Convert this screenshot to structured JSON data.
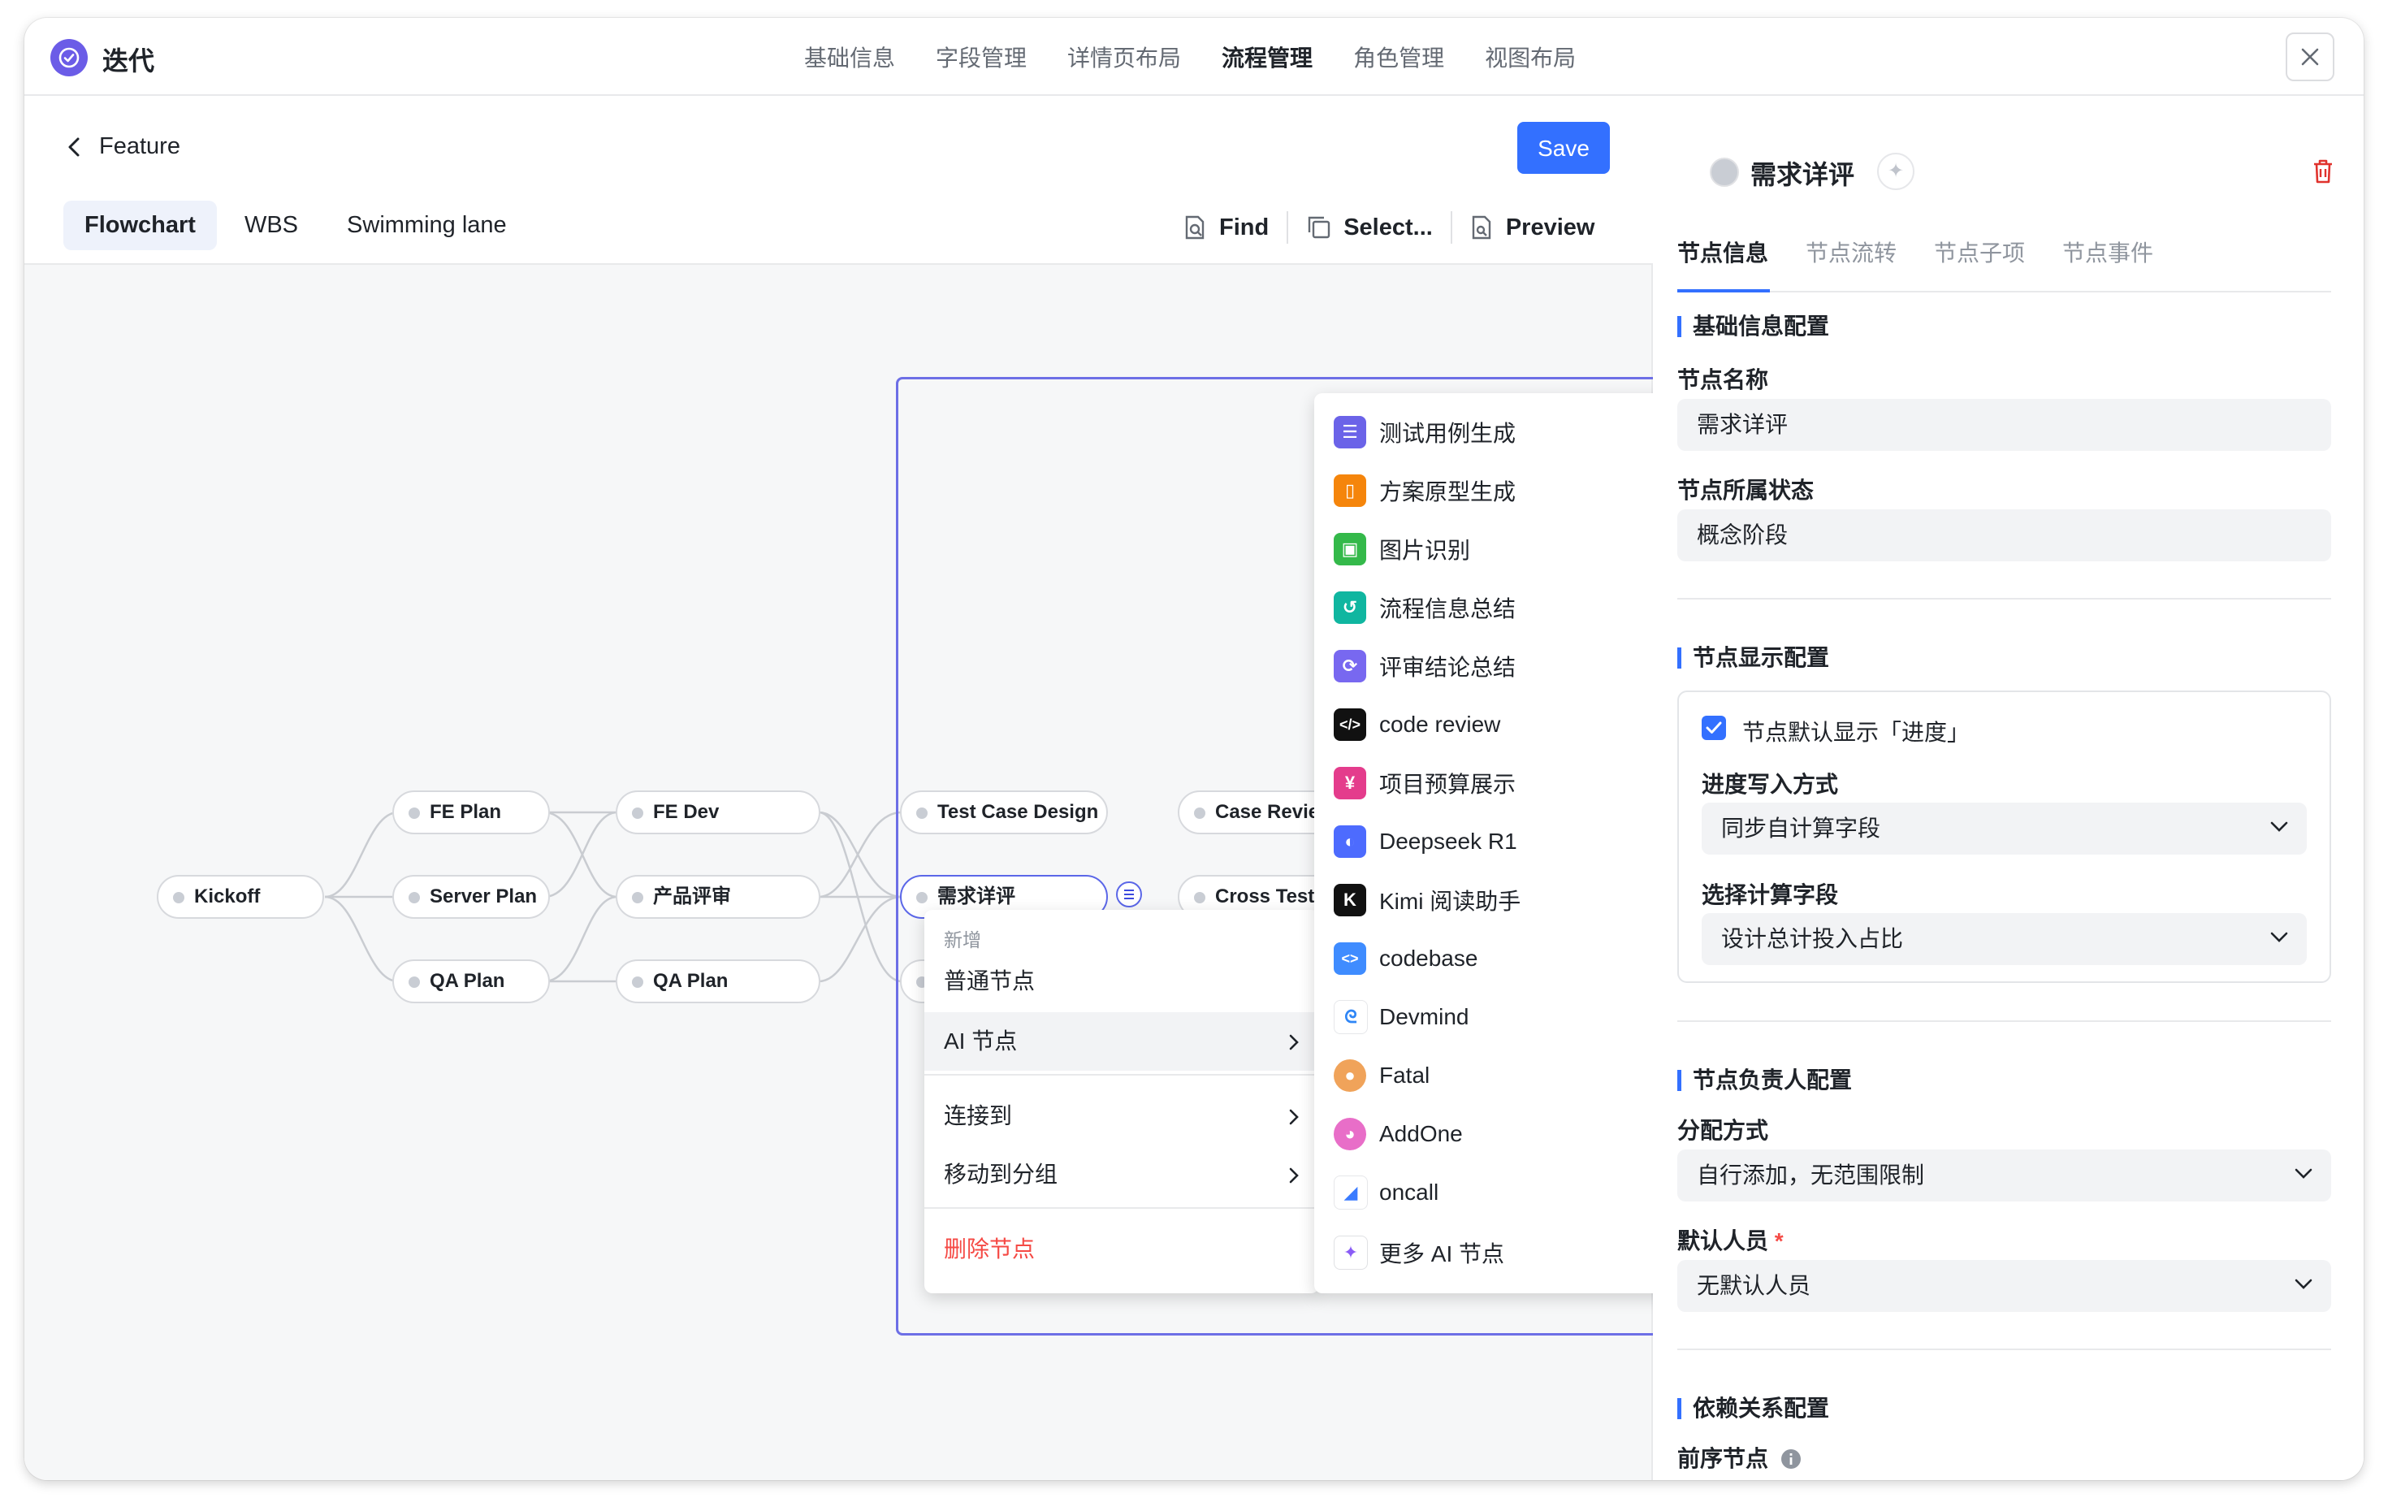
{
  "app": {
    "title": "迭代"
  },
  "top_tabs": [
    "基础信息",
    "字段管理",
    "详情页布局",
    "流程管理",
    "角色管理",
    "视图布局"
  ],
  "editor": {
    "back_label": "Feature",
    "save_label": "Save",
    "view_tabs": [
      "Flowchart",
      "WBS",
      "Swimming lane"
    ],
    "tools": {
      "find": "Find",
      "select": "Select...",
      "preview": "Preview"
    }
  },
  "flow": {
    "nodes": {
      "kickoff": "Kickoff",
      "fe_plan": "FE Plan",
      "server_plan": "Server Plan",
      "qa_plan_1": "QA Plan",
      "fe_dev": "FE Dev",
      "product_review": "产品评审",
      "qa_plan_2": "QA Plan",
      "test_case_design": "Test Case Design",
      "req_review": "需求详评",
      "case_review": "Case Review",
      "cross_test": "Cross Test"
    }
  },
  "context_menu": {
    "section": "新增",
    "items": {
      "normal_node": "普通节点",
      "ai_node": "AI 节点",
      "connect_to": "连接到",
      "move_to_group": "移动到分组",
      "delete_node": "删除节点"
    }
  },
  "ai_menu": {
    "items": [
      {
        "label": "测试用例生成",
        "icon": "list-icon",
        "color": "#6b63e8"
      },
      {
        "label": "方案原型生成",
        "icon": "phone-icon",
        "color": "#f5850b"
      },
      {
        "label": "图片识别",
        "icon": "image-icon",
        "color": "#34b94a"
      },
      {
        "label": "流程信息总结",
        "icon": "flow-icon",
        "color": "#10b6a0"
      },
      {
        "label": "评审结论总结",
        "icon": "refresh-icon",
        "color": "#7868f0"
      },
      {
        "label": "code review",
        "icon": "code-icon",
        "color": "#111111"
      },
      {
        "label": "项目预算展示",
        "icon": "yen-icon",
        "color": "#e43c8c"
      },
      {
        "label": "Deepseek R1",
        "icon": "deepseek-icon",
        "color": "#4d6bfe"
      },
      {
        "label": "Kimi 阅读助手",
        "icon": "kimi-icon",
        "color": "#111111"
      },
      {
        "label": "codebase",
        "icon": "codebase-icon",
        "color": "#3f8cff"
      },
      {
        "label": "Devmind",
        "icon": "devmind-icon",
        "color": "#2f86f6"
      },
      {
        "label": "Fatal",
        "icon": "fatal-icon",
        "color": "#f0a35a"
      },
      {
        "label": "AddOne",
        "icon": "addone-icon",
        "color": "#e86ec8"
      },
      {
        "label": "oncall",
        "icon": "oncall-icon",
        "color": "#3a7bff"
      },
      {
        "label": "更多 AI 节点",
        "icon": "sparkle-icon",
        "color": "#8a5cf6"
      }
    ]
  },
  "panel": {
    "node_title": "需求详评",
    "tabs": [
      "节点信息",
      "节点流转",
      "节点子项",
      "节点事件"
    ],
    "basic_section": "基础信息配置",
    "node_name_label": "节点名称",
    "node_name_value": "需求详评",
    "node_status_label": "节点所属状态",
    "node_status_value": "概念阶段",
    "display_section": "节点显示配置",
    "show_progress_label": "节点默认显示「进度」",
    "progress_mode_label": "进度写入方式",
    "progress_mode_value": "同步自计算字段",
    "calc_field_label": "选择计算字段",
    "calc_field_value": "设计总计投入占比",
    "owner_section": "节点负责人配置",
    "assign_mode_label": "分配方式",
    "assign_mode_value": "自行添加，无范围限制",
    "default_person_label": "默认人员",
    "default_person_value": "无默认人员",
    "dependency_section": "依赖关系配置",
    "predecessor_label": "前序节点"
  }
}
